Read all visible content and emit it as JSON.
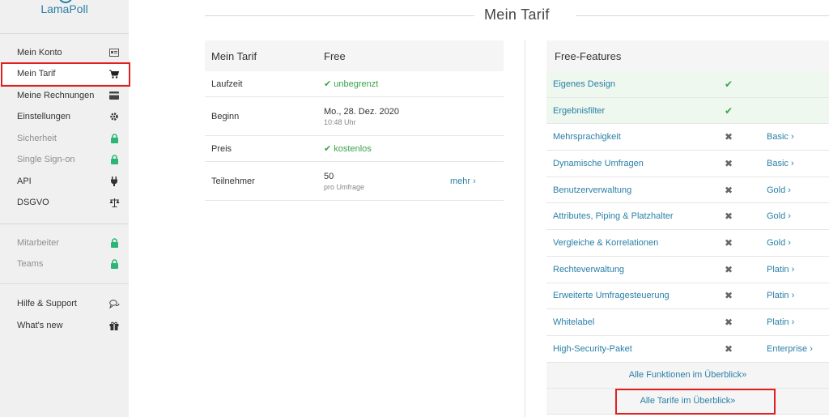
{
  "brand": {
    "name": "LamaPoll"
  },
  "sidebar": {
    "groups": [
      [
        {
          "label": "Mein Konto",
          "icon": "id-card-icon",
          "disabled": false,
          "active": false
        },
        {
          "label": "Mein Tarif",
          "icon": "cart-icon",
          "disabled": false,
          "active": true
        },
        {
          "label": "Meine Rechnungen",
          "icon": "credit-card-icon",
          "disabled": false,
          "active": false
        },
        {
          "label": "Einstellungen",
          "icon": "gear-icon",
          "disabled": false,
          "active": false
        },
        {
          "label": "Sicherheit",
          "icon": "lock-icon",
          "disabled": true,
          "active": false
        },
        {
          "label": "Single Sign-on",
          "icon": "lock-icon",
          "disabled": true,
          "active": false
        },
        {
          "label": "API",
          "icon": "plug-icon",
          "disabled": false,
          "active": false
        },
        {
          "label": "DSGVO",
          "icon": "scale-icon",
          "disabled": false,
          "active": false
        }
      ],
      [
        {
          "label": "Mitarbeiter",
          "icon": "lock-icon",
          "disabled": true,
          "active": false
        },
        {
          "label": "Teams",
          "icon": "lock-icon",
          "disabled": true,
          "active": false
        }
      ],
      [
        {
          "label": "Hilfe & Support",
          "icon": "chat-icon",
          "disabled": false,
          "active": false
        },
        {
          "label": "What's new",
          "icon": "gift-icon",
          "disabled": false,
          "active": false
        }
      ]
    ]
  },
  "page": {
    "title": "Mein Tarif"
  },
  "tarif": {
    "header": {
      "label": "Mein Tarif",
      "value": "Free"
    },
    "rows": [
      {
        "label": "Laufzeit",
        "value": "unbegrenzt",
        "check": true,
        "sub": "",
        "link": ""
      },
      {
        "label": "Beginn",
        "value": "Mo., 28. Dez. 2020",
        "check": false,
        "sub": "10:48 Uhr",
        "link": ""
      },
      {
        "label": "Preis",
        "value": "kostenlos",
        "check": true,
        "sub": "",
        "link": ""
      },
      {
        "label": "Teilnehmer",
        "value": "50",
        "check": false,
        "sub": "pro Umfrage",
        "link": "mehr ›"
      }
    ]
  },
  "features": {
    "header": "Free-Features",
    "rows": [
      {
        "name": "Eigenes Design",
        "included": true,
        "plan": ""
      },
      {
        "name": "Ergebnisfilter",
        "included": true,
        "plan": ""
      },
      {
        "name": "Mehrsprachigkeit",
        "included": false,
        "plan": "Basic ›"
      },
      {
        "name": "Dynamische Umfragen",
        "included": false,
        "plan": "Basic ›"
      },
      {
        "name": "Benutzerverwaltung",
        "included": false,
        "plan": "Gold ›"
      },
      {
        "name": "Attributes, Piping & Platzhalter",
        "included": false,
        "plan": "Gold ›"
      },
      {
        "name": "Vergleiche & Korrelationen",
        "included": false,
        "plan": "Gold ›"
      },
      {
        "name": "Rechteverwaltung",
        "included": false,
        "plan": "Platin ›"
      },
      {
        "name": "Erweiterte Umfragesteuerung",
        "included": false,
        "plan": "Platin ›"
      },
      {
        "name": "Whitelabel",
        "included": false,
        "plan": "Platin ›"
      },
      {
        "name": "High-Security-Paket",
        "included": false,
        "plan": "Enterprise ›"
      }
    ],
    "all_functions_link": "Alle Funktionen im Überblick»",
    "all_tariffs_link": "Alle Tarife im Überblick»"
  },
  "colors": {
    "accent": "#2a7fa8",
    "check": "#3aa34a",
    "lock": "#2bb673",
    "highlight": "#e02020",
    "included_bg": "#eef8ee"
  }
}
